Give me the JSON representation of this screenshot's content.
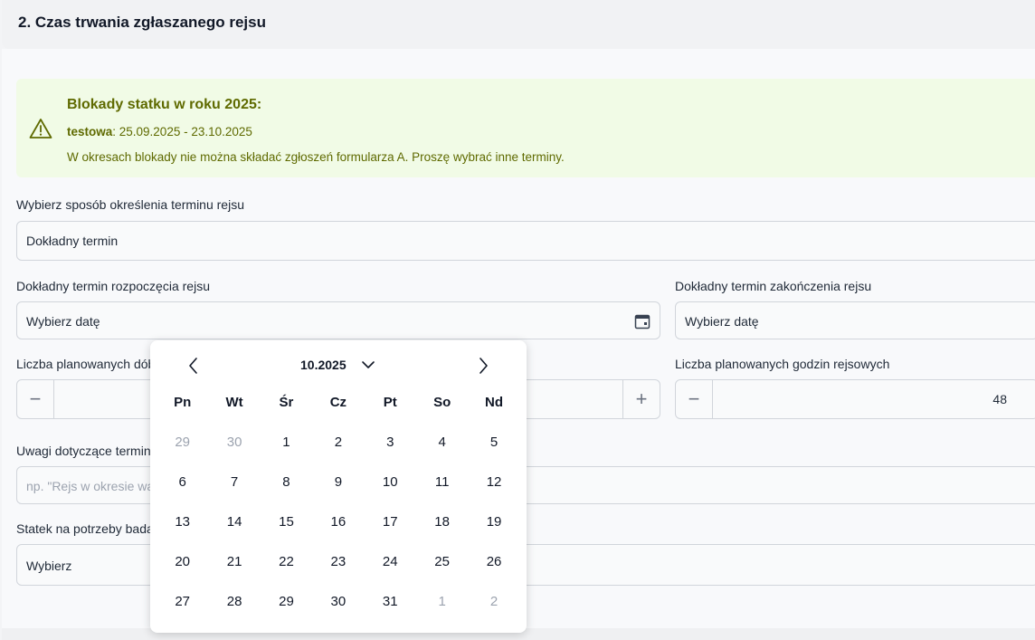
{
  "section": {
    "title": "2. Czas trwania zgłaszanego rejsu"
  },
  "alert": {
    "title": "Blokady statku w roku 2025:",
    "block_name": "testowa",
    "block_range": ": 25.09.2025 - 23.10.2025",
    "note": "W okresach blokady nie można składać zgłoszeń formularza A. Proszę wybrać inne terminy."
  },
  "term_mode": {
    "label": "Wybierz sposób określenia terminu rejsu",
    "value": "Dokładny termin"
  },
  "start_date": {
    "label": "Dokładny termin rozpoczęcia rejsu",
    "value": "Wybierz datę"
  },
  "end_date": {
    "label": "Dokładny termin zakończenia rejsu",
    "value": "Wybierz datę"
  },
  "days": {
    "label": "Liczba planowanych dób",
    "minus": "−",
    "plus": "+"
  },
  "hours": {
    "label": "Liczba planowanych godzin rejsowych",
    "value": "48",
    "minus": "−"
  },
  "remarks": {
    "label": "Uwagi dotyczące termin",
    "placeholder": "np. \"Rejs w okresie wa"
  },
  "ship": {
    "label": "Statek na potrzeby bada",
    "value": "Wybierz"
  },
  "datepicker": {
    "title": "10.2025",
    "weekdays": [
      "Pn",
      "Wt",
      "Śr",
      "Cz",
      "Pt",
      "So",
      "Nd"
    ],
    "weeks": [
      [
        {
          "d": "29",
          "m": true
        },
        {
          "d": "30",
          "m": true
        },
        {
          "d": "1"
        },
        {
          "d": "2"
        },
        {
          "d": "3"
        },
        {
          "d": "4"
        },
        {
          "d": "5"
        }
      ],
      [
        {
          "d": "6"
        },
        {
          "d": "7"
        },
        {
          "d": "8"
        },
        {
          "d": "9"
        },
        {
          "d": "10"
        },
        {
          "d": "11"
        },
        {
          "d": "12"
        }
      ],
      [
        {
          "d": "13"
        },
        {
          "d": "14"
        },
        {
          "d": "15"
        },
        {
          "d": "16"
        },
        {
          "d": "17"
        },
        {
          "d": "18"
        },
        {
          "d": "19"
        }
      ],
      [
        {
          "d": "20"
        },
        {
          "d": "21"
        },
        {
          "d": "22"
        },
        {
          "d": "23"
        },
        {
          "d": "24"
        },
        {
          "d": "25"
        },
        {
          "d": "26"
        }
      ],
      [
        {
          "d": "27"
        },
        {
          "d": "28"
        },
        {
          "d": "29"
        },
        {
          "d": "30"
        },
        {
          "d": "31"
        },
        {
          "d": "1",
          "m": true
        },
        {
          "d": "2",
          "m": true
        }
      ]
    ]
  }
}
